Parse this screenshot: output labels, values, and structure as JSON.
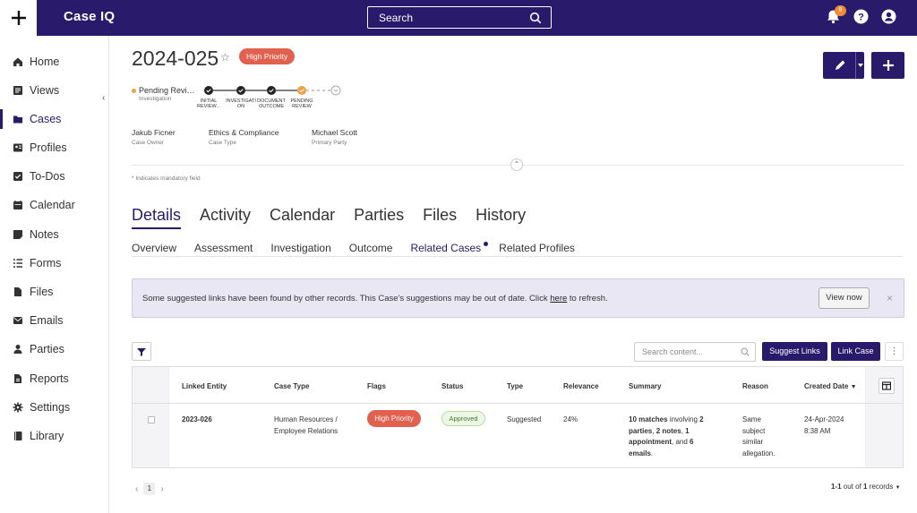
{
  "header": {
    "brand": "Case IQ",
    "search_placeholder": "Search",
    "notification_count": "9",
    "icons": [
      "plus-icon",
      "search-icon",
      "bell-icon",
      "help-icon",
      "user-icon"
    ]
  },
  "sidebar": {
    "items": [
      {
        "label": "Home",
        "icon": "home-icon"
      },
      {
        "label": "Views",
        "icon": "views-icon"
      },
      {
        "label": "Cases",
        "icon": "folder-icon",
        "active": true
      },
      {
        "label": "Profiles",
        "icon": "profiles-icon"
      },
      {
        "label": "To-Dos",
        "icon": "checkbox-icon"
      },
      {
        "label": "Calendar",
        "icon": "calendar-icon"
      },
      {
        "label": "Notes",
        "icon": "notes-icon"
      },
      {
        "label": "Forms",
        "icon": "forms-icon"
      },
      {
        "label": "Files",
        "icon": "file-icon"
      },
      {
        "label": "Emails",
        "icon": "email-icon"
      },
      {
        "label": "Parties",
        "icon": "person-icon"
      },
      {
        "label": "Reports",
        "icon": "reports-icon"
      },
      {
        "label": "Settings",
        "icon": "gear-icon"
      },
      {
        "label": "Library",
        "icon": "book-icon"
      }
    ]
  },
  "case": {
    "id": "2024-025",
    "priority": "High Priority",
    "stage_current": "Pending Revi…",
    "stage_sub": "Investigation",
    "steps": [
      {
        "label": "INITIAL REVIEW...",
        "state": "done"
      },
      {
        "label": "INVESTIGATI ON",
        "state": "done"
      },
      {
        "label": "DOCUMENT OUTCOME",
        "state": "done"
      },
      {
        "label": "PENDING REVIEW",
        "state": "current"
      },
      {
        "label": "",
        "state": "future"
      }
    ],
    "meta": [
      {
        "value": "Jakub Ficner",
        "label": "Case Owner"
      },
      {
        "value": "Ethics & Compliance",
        "label": "Case Type"
      },
      {
        "value": "Michael Scott",
        "label": "Primary Party"
      }
    ],
    "mandatory_note": "* Indicates mandatory field"
  },
  "tabs": [
    "Details",
    "Activity",
    "Calendar",
    "Parties",
    "Files",
    "History"
  ],
  "active_tab": "Details",
  "subtabs": [
    "Overview",
    "Assessment",
    "Investigation",
    "Outcome",
    "Related Cases",
    "Related Profiles"
  ],
  "active_subtab": "Related Cases",
  "banner": {
    "text_before": "Some suggested links have been found by other records. This Case's suggestions may be out of date. Click ",
    "link": "here",
    "text_after": " to refresh.",
    "button": "View now"
  },
  "toolbar": {
    "search_placeholder": "Search content...",
    "suggest_links": "Suggest Links",
    "link_case": "Link Case",
    "more": "⋮"
  },
  "table": {
    "headers": [
      "Linked Entity",
      "Case Type",
      "Flags",
      "Status",
      "Type",
      "Relevance",
      "Summary",
      "Reason",
      "Created Date"
    ],
    "sort_column": "Created Date",
    "rows": [
      {
        "linked_entity": "2023-026",
        "case_type_1": "Human Resources /",
        "case_type_2": "Employee Relations",
        "flag": "High Priority",
        "status": "Approved",
        "type": "Suggested",
        "relevance": "24%",
        "summary": {
          "matches": "10 matches",
          "involving": " involving ",
          "parties_num": "2",
          "parties": "parties",
          "notes": "2 notes",
          "appt": "1 appointment",
          "and": ", and ",
          "emails": "6 emails"
        },
        "reason": [
          "Same",
          "subject",
          "similar",
          "allegation."
        ],
        "created_date": "24-Apr-2024",
        "created_time": "8:38 AM"
      }
    ]
  },
  "pager": {
    "page": "1",
    "range": "1-1",
    "out_of": " out of ",
    "total": "1",
    "records": " records"
  },
  "colors": {
    "primary": "#2a1a6b",
    "priority": "#e2604e",
    "pending": "#f0a044",
    "banner_bg": "#eae7f5"
  }
}
